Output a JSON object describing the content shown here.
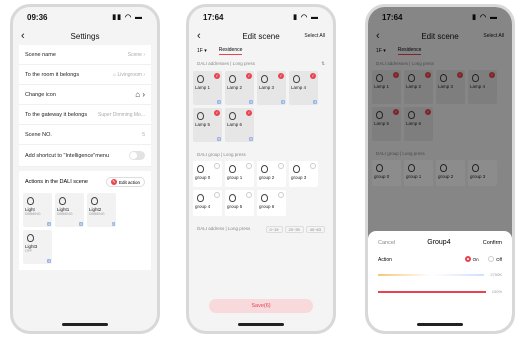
{
  "status": {
    "time1": "09:36",
    "time2": "17:64",
    "time3": "17:64"
  },
  "settings": {
    "title": "Settings",
    "rows": [
      {
        "label": "Scene name",
        "value": "Scene"
      },
      {
        "label": "To the room it belongs",
        "value": "Livingroom"
      },
      {
        "label": "Change icon",
        "value": ""
      },
      {
        "label": "To the gateway it belongs",
        "value": "Super Dimming Mo..."
      },
      {
        "label": "Scene NO.",
        "value": "5"
      },
      {
        "label": "Add shortcut to \"Intelligence\"menu",
        "value": ""
      }
    ],
    "actions_title": "Actions in the DALI scene",
    "edit_action": "Edit action",
    "tiles": [
      {
        "name": "Light",
        "sub": "DIMMING",
        "badge": "a"
      },
      {
        "name": "Light1",
        "sub": "DIMMING",
        "badge": "b"
      },
      {
        "name": "Light2",
        "sub": "DIMMING",
        "badge": "c"
      },
      {
        "name": "Light3",
        "sub": "OFF",
        "badge": "d"
      }
    ]
  },
  "edit": {
    "title": "Edit scene",
    "select_all": "Select All",
    "tab1": "1F",
    "tab2": "Residence",
    "addresses_label": "DALI addresses | Long press",
    "lamps": [
      {
        "name": "Lamp 1",
        "badge": "1"
      },
      {
        "name": "Lamp 2",
        "badge": "2"
      },
      {
        "name": "Lamp 3",
        "badge": "3"
      },
      {
        "name": "Lamp 4",
        "badge": "4"
      },
      {
        "name": "Lamp 5",
        "badge": "5"
      },
      {
        "name": "Lamp 6",
        "badge": "6"
      }
    ],
    "groups_label": "DALI group | Long press",
    "groups": [
      "group 0",
      "group 1",
      "group 2",
      "group 3",
      "group 4",
      "group 5",
      "group 6"
    ],
    "short_label": "DALI address | Long press",
    "ranges": [
      "0~19",
      "20~39",
      "40~63"
    ],
    "save": "Save(6)"
  },
  "sheet": {
    "cancel": "Cancel",
    "title": "Group4",
    "confirm": "Confirm",
    "action": "Action",
    "on": "On",
    "off": "Off",
    "val1": "2700K",
    "val2": "100%"
  }
}
